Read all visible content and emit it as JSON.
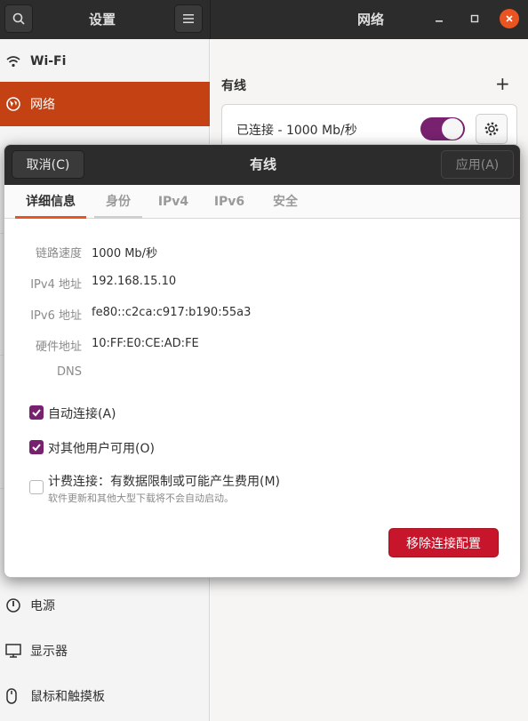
{
  "header": {
    "settings_title": "设置",
    "panel_title": "网络"
  },
  "sidebar": {
    "items": [
      {
        "label": "Wi-Fi",
        "icon": "wifi-icon"
      },
      {
        "label": "网络",
        "icon": "network-icon",
        "active": true
      },
      {
        "label": "电源",
        "icon": "power-icon"
      },
      {
        "label": "显示器",
        "icon": "display-icon"
      },
      {
        "label": "鼠标和触摸板",
        "icon": "mouse-icon"
      }
    ]
  },
  "main": {
    "section_title": "有线",
    "add_symbol": "+",
    "connection": {
      "status": "已连接 - 1000 Mb/秒",
      "enabled": true
    }
  },
  "dialog": {
    "cancel_label": "取消(C)",
    "title": "有线",
    "apply_label": "应用(A)",
    "tabs": [
      "详细信息",
      "身份",
      "IPv4",
      "IPv6",
      "安全"
    ],
    "details": {
      "link_speed_label": "链路速度",
      "link_speed": "1000 Mb/秒",
      "ipv4_label": "IPv4 地址",
      "ipv4": "192.168.15.10",
      "ipv6_label": "IPv6 地址",
      "ipv6": "fe80::c2ca:c917:b190:55a3",
      "hw_label": "硬件地址",
      "hw": "10:FF:E0:CE:AD:FE",
      "dns_label": "DNS",
      "dns": ""
    },
    "auto_connect_label": "自动连接(A)",
    "auto_connect": true,
    "all_users_label": "对其他用户可用(O)",
    "all_users": true,
    "metered_label": "计费连接：有数据限制或可能产生费用(M)",
    "metered_sub": "软件更新和其他大型下载将不会自动启动。",
    "metered": false,
    "remove_label": "移除连接配置"
  },
  "colors": {
    "accent": "#e95420",
    "sidebar_active": "#c34113",
    "check": "#77216f",
    "danger": "#c7162b"
  }
}
